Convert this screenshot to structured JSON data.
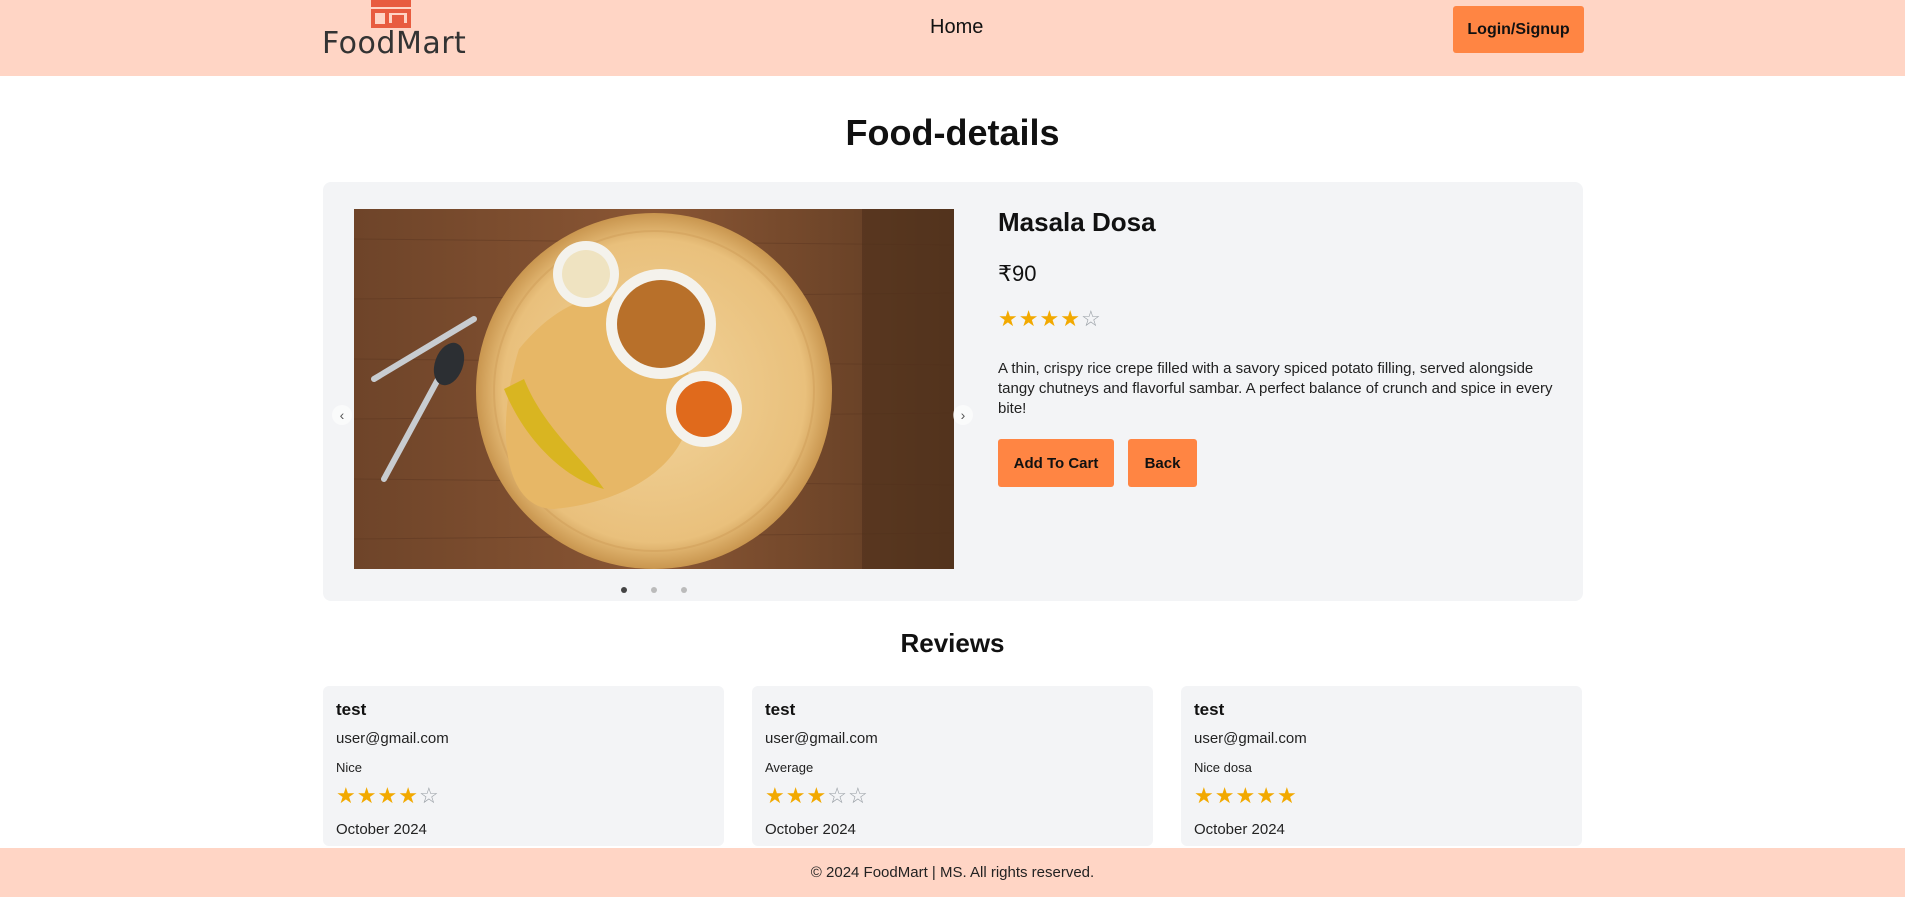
{
  "header": {
    "logo_text": "FoodMart",
    "nav_home": "Home",
    "login_label": "Login/Signup"
  },
  "page_title": "Food-details",
  "food": {
    "name": "Masala Dosa",
    "price": "₹90",
    "rating": 4,
    "rating_max": 5,
    "description": "A thin, crispy rice crepe filled with a savory spiced potato filling, served alongside tangy chutneys and flavorful sambar. A perfect balance of crunch and spice in every bite!",
    "add_to_cart_label": "Add To Cart",
    "back_label": "Back",
    "carousel_slides": 3,
    "carousel_active": 0
  },
  "reviews_title": "Reviews",
  "reviews": [
    {
      "name": "test",
      "email": "user@gmail.com",
      "comment": "Nice",
      "rating": 4,
      "date": "October 2024"
    },
    {
      "name": "test",
      "email": "user@gmail.com",
      "comment": "Average",
      "rating": 3,
      "date": "October 2024"
    },
    {
      "name": "test",
      "email": "user@gmail.com",
      "comment": "Nice dosa",
      "rating": 5,
      "date": "October 2024"
    }
  ],
  "footer_text": "© 2024 FoodMart | MS. All rights reserved.",
  "colors": {
    "header_bg": "#ffd5c5",
    "button": "#ff8543",
    "card_bg": "#f3f4f6",
    "star": "#f2a900"
  },
  "icons": [
    "store-icon",
    "star-icon",
    "chevron-left-icon",
    "chevron-right-icon"
  ]
}
